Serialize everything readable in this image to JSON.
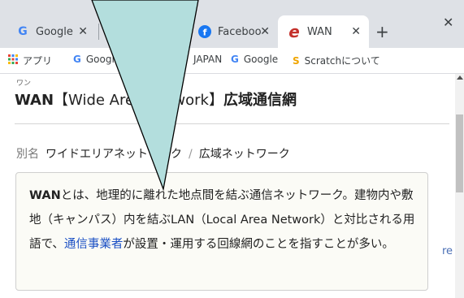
{
  "tabs": [
    {
      "label": "Google",
      "icon": "google-g-icon"
    },
    {
      "label": "",
      "icon": "hidden-tab-icon"
    },
    {
      "label": "Faceboo",
      "icon": "facebook-icon"
    },
    {
      "label": "WAN",
      "icon": "edge-icon"
    }
  ],
  "new_tab_symbol": "+",
  "bookmarks": [
    {
      "label": "アプリ",
      "icon": "apps-grid-icon"
    },
    {
      "label": "Google",
      "icon": "google-g-icon"
    },
    {
      "label": "JAPAN",
      "icon": "bookmark-icon"
    },
    {
      "label": "Google",
      "icon": "google-g-icon"
    },
    {
      "label": "Scratchについて",
      "icon": "scratch-icon"
    }
  ],
  "article": {
    "ruby": "ワン",
    "title_en": "WAN",
    "title_bracket": "【Wide Area Network】",
    "title_jp": "広域通信網",
    "alias_label": "別名",
    "alias_1": "ワイドエリアネットワーク",
    "alias_sep": "/",
    "alias_2": "広域ネットワーク",
    "definition_bold": "WAN",
    "definition_1": "とは、地理的に離れた地点間を結ぶ通信ネットワーク。建物内や敷地（キャンパス）内を結ぶLAN（Local Area Network）と対比される用語で、",
    "definition_link": "通信事業者",
    "definition_2": "が設置・運用する回線網のことを指すことが多い。",
    "side_text": "re"
  },
  "colors": {
    "overlay_fill": "#b3dedd",
    "link": "#1a4fc4",
    "chrome": "#dee1e6"
  }
}
